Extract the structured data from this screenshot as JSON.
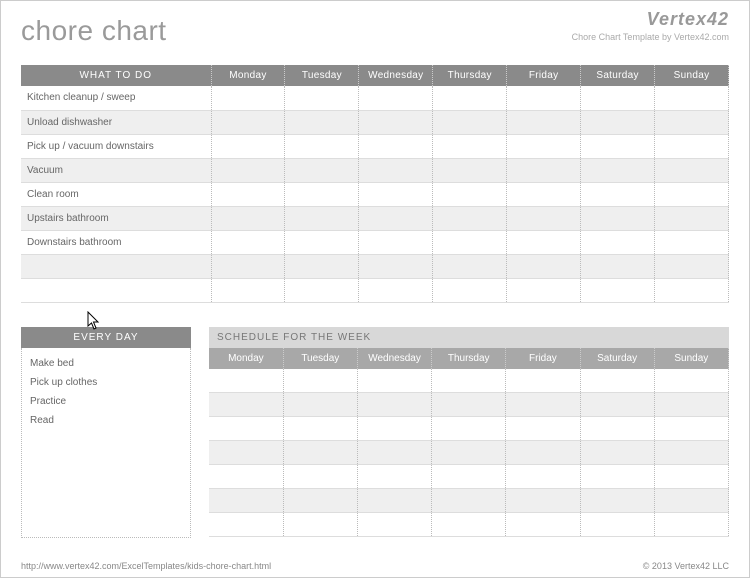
{
  "title": "chore chart",
  "brand": {
    "logo": "Vertex42",
    "sub": "Chore Chart Template by Vertex42.com"
  },
  "days": [
    "Monday",
    "Tuesday",
    "Wednesday",
    "Thursday",
    "Friday",
    "Saturday",
    "Sunday"
  ],
  "main_header": "WHAT TO DO",
  "chores": [
    "Kitchen cleanup / sweep",
    "Unload dishwasher",
    "Pick up / vacuum downstairs",
    "Vacuum",
    "Clean room",
    "Upstairs bathroom",
    "Downstairs bathroom",
    "",
    ""
  ],
  "everyday_header": "EVERY DAY",
  "everyday": [
    "Make bed",
    "Pick up clothes",
    "Practice",
    "Read"
  ],
  "schedule_header": "SCHEDULE FOR THE WEEK",
  "footer_left": "http://www.vertex42.com/ExcelTemplates/kids-chore-chart.html",
  "footer_right": "© 2013 Vertex42 LLC"
}
